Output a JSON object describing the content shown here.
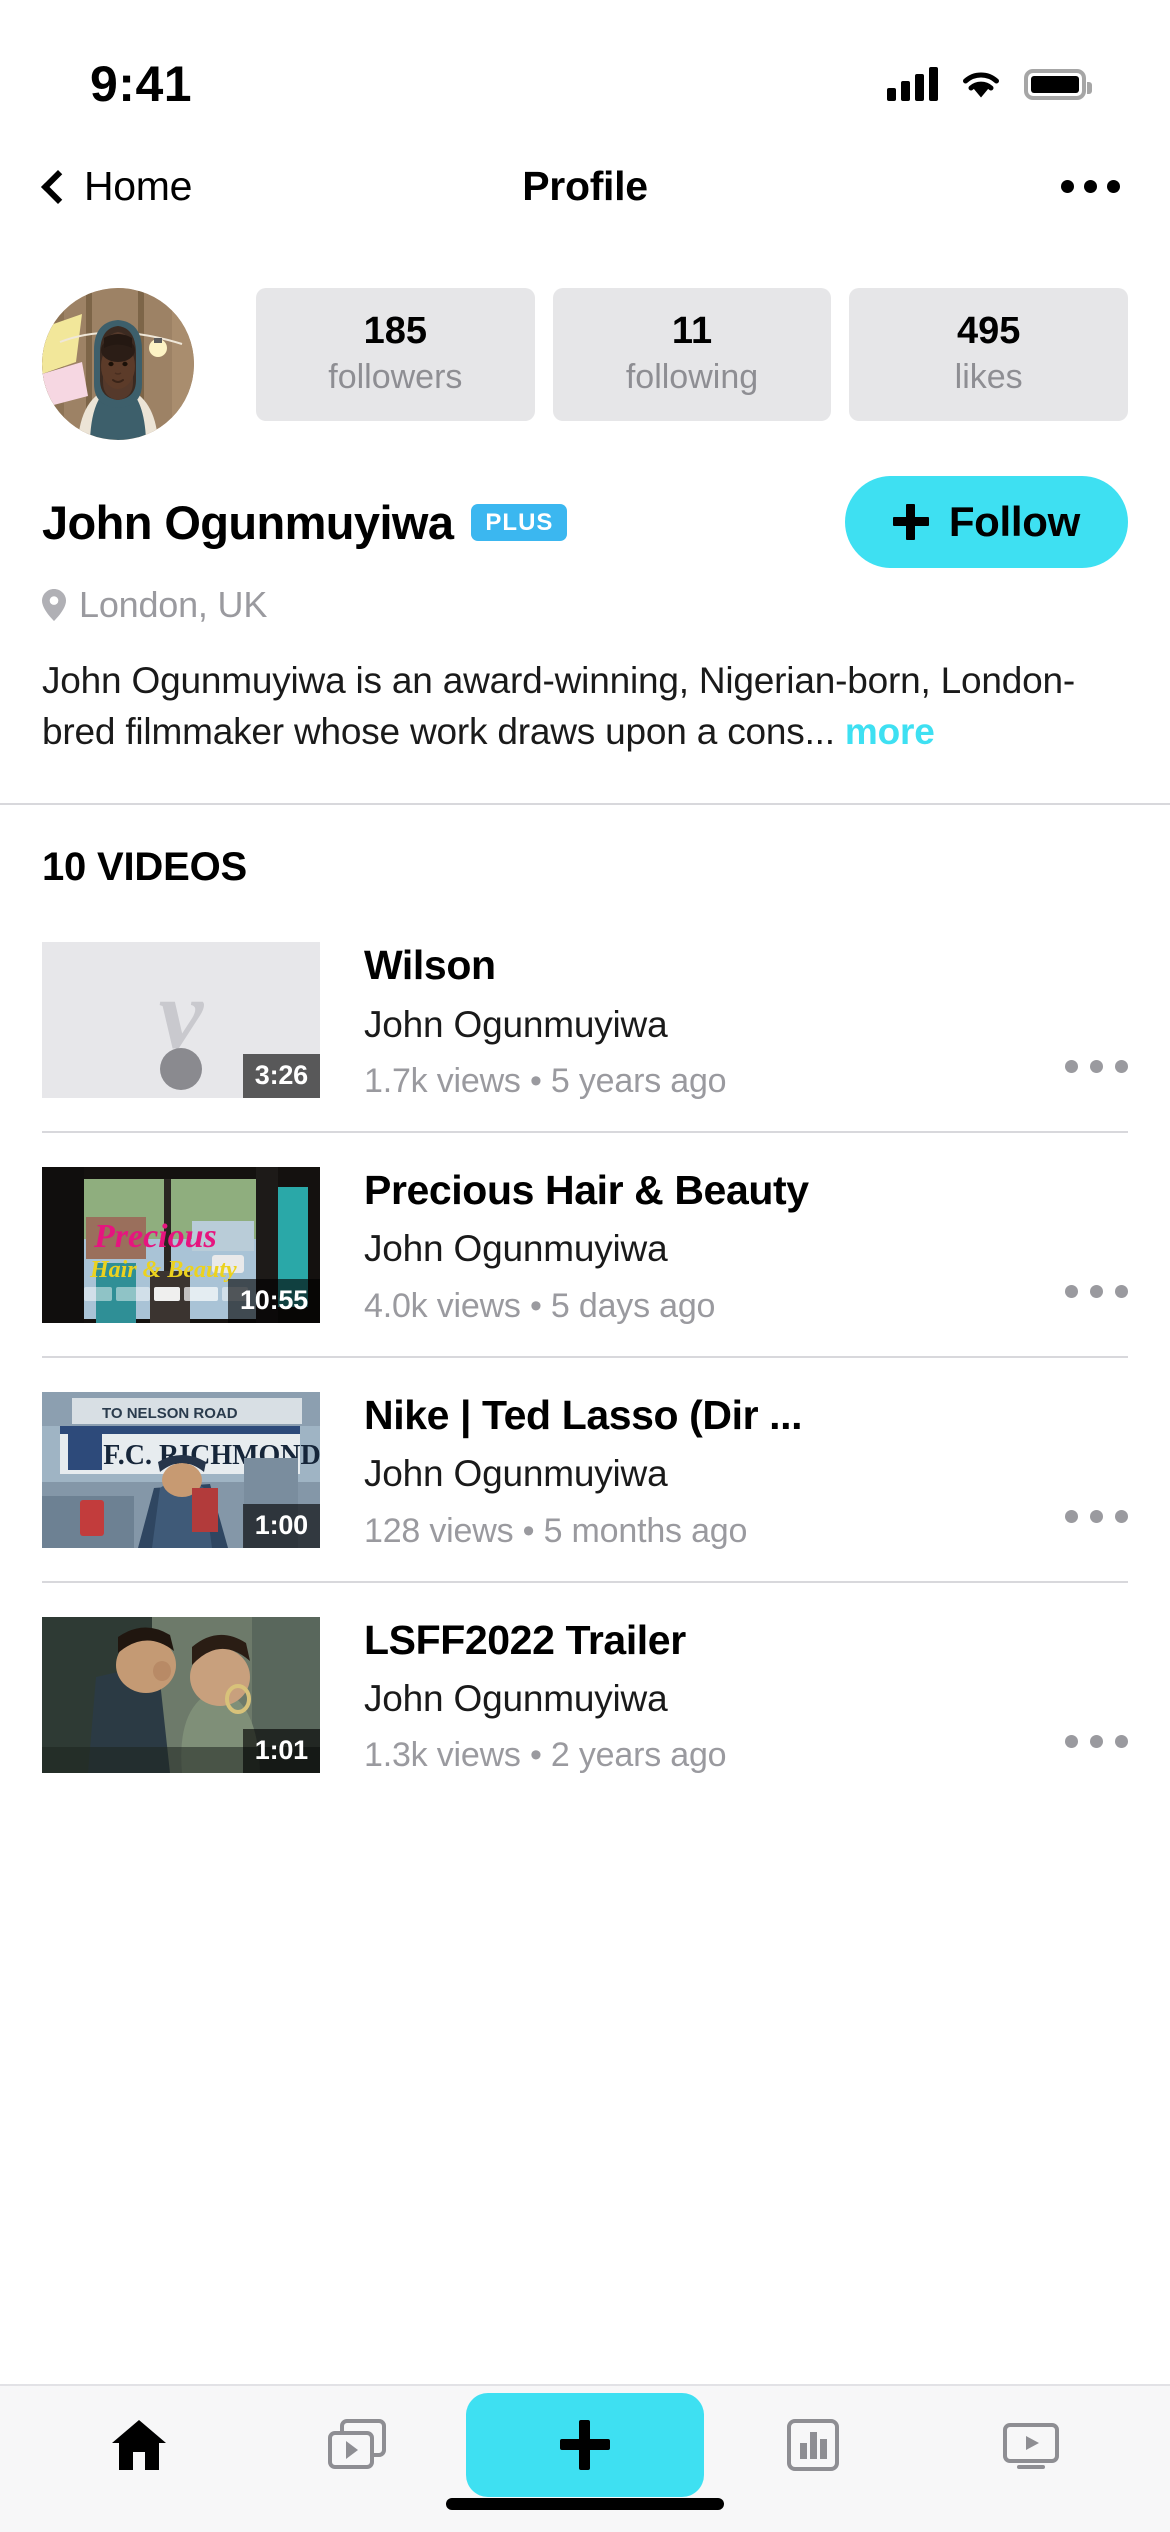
{
  "status_bar": {
    "time": "9:41",
    "cellular_icon": "signal-bars-icon",
    "wifi_icon": "wifi-icon",
    "battery_icon": "battery-full-icon"
  },
  "nav_bar": {
    "back_label": "Home",
    "back_icon": "chevron-left-icon",
    "title": "Profile",
    "more_icon": "ellipsis-icon"
  },
  "profile": {
    "avatar_alt": "avatar",
    "display_name": "John Ogunmuyiwa",
    "badge": "PLUS",
    "location": "London, UK",
    "location_icon": "location-pin-icon",
    "bio": "John Ogunmuyiwa is an award-winning, Nigerian-born, London-bred filmmaker whose work draws upon a cons...",
    "bio_more": "more",
    "follow_button": {
      "label": "Follow",
      "icon": "plus-icon"
    },
    "stats": [
      {
        "value": "185",
        "label": "followers"
      },
      {
        "value": "11",
        "label": "following"
      },
      {
        "value": "495",
        "label": "likes"
      }
    ]
  },
  "videos_section": {
    "heading": "10 VIDEOS",
    "items": [
      {
        "title": "Wilson",
        "author": "John Ogunmuyiwa",
        "stats": "1.7k views • 5 years ago",
        "duration": "3:26",
        "thumb_state": "loading-placeholder",
        "more_icon": "ellipsis-icon"
      },
      {
        "title": "Precious Hair & Beauty",
        "author": "John Ogunmuyiwa",
        "stats": "4.0k views • 5 days ago",
        "duration": "10:55",
        "thumb_state": "image",
        "more_icon": "ellipsis-icon"
      },
      {
        "title": "Nike | Ted Lasso (Dir ...",
        "author": "John Ogunmuyiwa",
        "stats": "128 views • 5 months ago",
        "duration": "1:00",
        "thumb_state": "image",
        "more_icon": "ellipsis-icon"
      },
      {
        "title": "LSFF2022 Trailer",
        "author": "John Ogunmuyiwa",
        "stats": "1.3k views • 2 years ago",
        "duration": "1:01",
        "thumb_state": "image",
        "more_icon": "ellipsis-icon"
      }
    ]
  },
  "tab_bar": {
    "items": [
      {
        "name": "home",
        "icon": "home-icon",
        "active": true
      },
      {
        "name": "library",
        "icon": "collections-icon",
        "active": false
      },
      {
        "name": "upload",
        "icon": "plus-icon",
        "active": false
      },
      {
        "name": "stats",
        "icon": "bar-chart-icon",
        "active": false
      },
      {
        "name": "watch",
        "icon": "tv-icon",
        "active": false
      }
    ]
  },
  "colors": {
    "accent": "#3ee0f2",
    "badge": "#3bb7f0",
    "muted_text": "#9a9a9f",
    "chip_bg": "#e6e6e8"
  }
}
